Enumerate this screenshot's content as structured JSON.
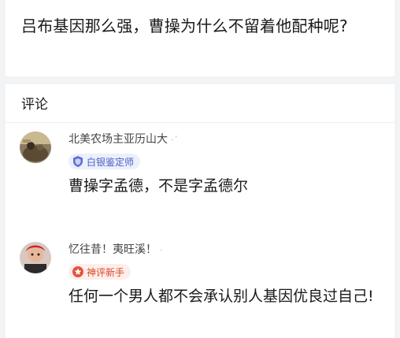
{
  "question": {
    "title": "吕布基因那么强，曹操为什么不留着他配种呢?"
  },
  "comments_section": {
    "heading": "评论",
    "comments": [
      {
        "username": "北美农场主亚历山大",
        "username_suffix": "·´",
        "badge": "白银鉴定师",
        "badge_icon": "shield-icon",
        "badge_color": "#4a5fc1",
        "text": "曹操字孟德，不是字孟德尔"
      },
      {
        "username": "忆往昔！夷旺溪！",
        "username_suffix": "·",
        "badge": "神评新手",
        "badge_icon": "medal-icon",
        "badge_color": "#d9472b",
        "text": "任何一个男人都不会承认别人基因优良过自己!"
      }
    ]
  }
}
